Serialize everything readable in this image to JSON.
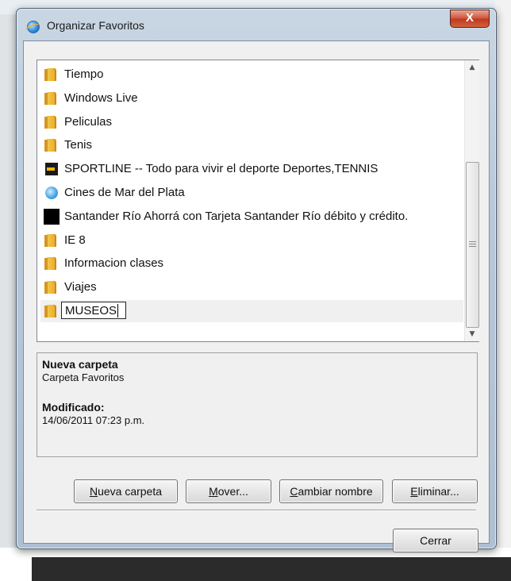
{
  "window": {
    "title": "Organizar Favoritos",
    "close_label": "X"
  },
  "favorites": [
    {
      "label": "Tiempo",
      "icon": "folder-icon"
    },
    {
      "label": "Windows Live",
      "icon": "folder-icon"
    },
    {
      "label": "Peliculas",
      "icon": "folder-icon"
    },
    {
      "label": "Tenis",
      "icon": "folder-icon"
    },
    {
      "label": "SPORTLINE -- Todo para vivir el deporte Deportes,TENNIS",
      "icon": "sportline-favicon-icon"
    },
    {
      "label": "Cines de Mar del Plata",
      "icon": "ie-page-icon"
    },
    {
      "label": "Santander Río Ahorrá con Tarjeta Santander Río débito y crédito.",
      "icon": "black-favicon-icon"
    },
    {
      "label": "IE 8",
      "icon": "folder-icon"
    },
    {
      "label": "Informacion clases",
      "icon": "folder-icon"
    },
    {
      "label": "Viajes",
      "icon": "folder-icon"
    }
  ],
  "rename": {
    "value": "MUSEOS"
  },
  "details": {
    "name": "Nueva carpeta",
    "type": "Carpeta Favoritos",
    "modified_label": "Modificado:",
    "modified_value": "14/06/2011 07:23 p.m."
  },
  "buttons": {
    "new_folder": {
      "mnemonic": "N",
      "rest": "ueva carpeta"
    },
    "move": {
      "mnemonic": "M",
      "rest": "over..."
    },
    "rename": {
      "mnemonic": "C",
      "rest": "ambiar nombre"
    },
    "delete": {
      "mnemonic": "E",
      "rest": "liminar..."
    },
    "close": "Cerrar"
  }
}
